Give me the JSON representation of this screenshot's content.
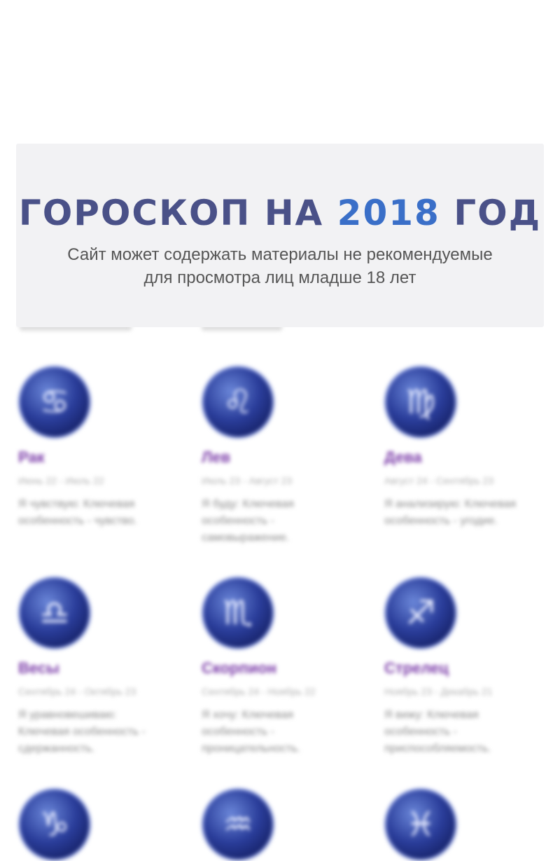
{
  "banner": {
    "title_prefix": "ГОРОСКОП НА ",
    "title_year": "2018",
    "title_suffix": " ГОД",
    "subtitle": "Сайт может содержать материалы не рекомендуемые для просмотра лиц младше 18 лет"
  },
  "signs": [
    {
      "name": "Рак",
      "dates": "Июнь 22 - Июль 22",
      "desc": "Я чувствую: Ключевая особенность - чувство.",
      "icon": "cancer-icon",
      "glyph": "♋"
    },
    {
      "name": "Лев",
      "dates": "Июль 23 - Август 23",
      "desc": "Я буду: Ключевая особенность - самовыражение.",
      "icon": "leo-icon",
      "glyph": "♌"
    },
    {
      "name": "Дева",
      "dates": "Август 24 - Сентябрь 23",
      "desc": "Я анализирую: Ключевая особенность - угодие.",
      "icon": "virgo-icon",
      "glyph": "♍"
    },
    {
      "name": "Весы",
      "dates": "Сентябрь 24 - Октябрь 23",
      "desc": "Я уравновешиваю: Ключевая особенность - сдержанность.",
      "icon": "libra-icon",
      "glyph": "♎"
    },
    {
      "name": "Скорпион",
      "dates": "Сентябрь 24 - Ноябрь 22",
      "desc": "Я хочу: Ключевая особенность - проницательность.",
      "icon": "scorpio-icon",
      "glyph": "♏"
    },
    {
      "name": "Стрелец",
      "dates": "Ноябрь 23 - Декабрь 21",
      "desc": "Я вижу: Ключевая особенность - приспособляемость.",
      "icon": "sagittarius-icon",
      "glyph": "♐"
    },
    {
      "name": "",
      "dates": "",
      "desc": "",
      "icon": "capricorn-icon",
      "glyph": "♑"
    },
    {
      "name": "",
      "dates": "",
      "desc": "",
      "icon": "aquarius-icon",
      "glyph": "♒"
    },
    {
      "name": "",
      "dates": "",
      "desc": "",
      "icon": "pisces-icon",
      "glyph": "♓"
    }
  ]
}
